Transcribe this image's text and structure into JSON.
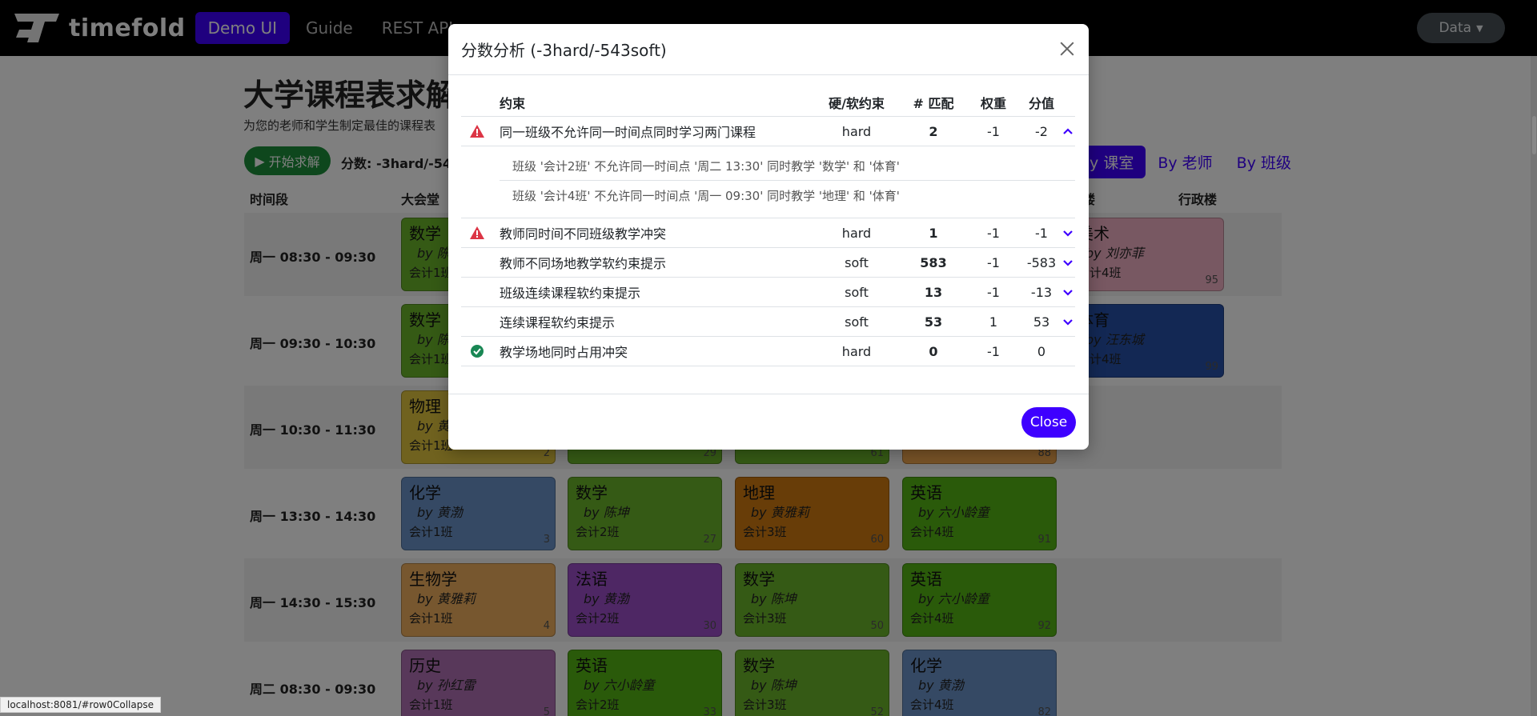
{
  "navbar": {
    "brand": "timefold",
    "links": [
      "Demo UI",
      "Guide",
      "REST API"
    ],
    "data_button": "Data"
  },
  "page": {
    "title": "大学课程表求解",
    "subtitle": "为您的老师和学生制定最佳的课程表",
    "solve_button": "开始求解",
    "score_label": "分数: -3hard/-543soft",
    "view_tabs": [
      "By 课室",
      "By 老师",
      "By 班级"
    ],
    "columns": [
      "时间段",
      "大会堂",
      "东楼",
      "行政楼"
    ],
    "rows": [
      {
        "time": "周一 08:30 - 09:30",
        "lessons": [
          {
            "subject": "数学",
            "teacher": "by 陈坤",
            "group": "会计1班",
            "id": "1",
            "color": "#6bb42b"
          },
          {
            "subject": "美术",
            "teacher": "by 刘亦菲",
            "group": "会计4班",
            "id": "95",
            "color": "#f0b0c4"
          }
        ]
      },
      {
        "time": "周一 09:30 - 10:30",
        "lessons": [
          {
            "subject": "数学",
            "teacher": "by 陈坤",
            "group": "会计1班",
            "id": "1",
            "color": "#6bb42b"
          },
          {
            "subject": "体育",
            "teacher": "by 汪东城",
            "group": "会计4班",
            "id": "99",
            "color": "#2650a8"
          }
        ]
      },
      {
        "time": "周一 10:30 - 11:30",
        "lessons": [
          {
            "subject": "物理",
            "teacher": "by 黄渤",
            "group": "会计1班",
            "id": "2",
            "color": "#e0c43e"
          },
          {
            "subject": "",
            "teacher": "",
            "group": "会计2班",
            "id": "29",
            "color": "#6bb42b"
          },
          {
            "subject": "",
            "teacher": "",
            "group": "会计3班",
            "id": "61",
            "color": "#6bb42b"
          },
          {
            "subject": "",
            "teacher": "",
            "group": "会计4班",
            "id": "88",
            "color": "#f0a64e"
          }
        ]
      },
      {
        "time": "周一 13:30 - 14:30",
        "lessons": [
          {
            "subject": "化学",
            "teacher": "by 黄渤",
            "group": "会计1班",
            "id": "3",
            "color": "#6a93c8"
          },
          {
            "subject": "数学",
            "teacher": "by 陈坤",
            "group": "会计2班",
            "id": "27",
            "color": "#6bb42b"
          },
          {
            "subject": "地理",
            "teacher": "by 黄雅莉",
            "group": "会计3班",
            "id": "60",
            "color": "#d07a10"
          },
          {
            "subject": "英语",
            "teacher": "by 六小龄童",
            "group": "会计4班",
            "id": "91",
            "color": "#55b414"
          }
        ]
      },
      {
        "time": "周一 14:30 - 15:30",
        "lessons": [
          {
            "subject": "生物学",
            "teacher": "by 黄雅莉",
            "group": "会计1班",
            "id": "4",
            "color": "#eeae5e"
          },
          {
            "subject": "法语",
            "teacher": "by 黄渤",
            "group": "会计2班",
            "id": "30",
            "color": "#9c4ec8"
          },
          {
            "subject": "数学",
            "teacher": "by 陈坤",
            "group": "会计3班",
            "id": "50",
            "color": "#6bb42b"
          },
          {
            "subject": "英语",
            "teacher": "by 六小龄童",
            "group": "会计4班",
            "id": "92",
            "color": "#55b414"
          }
        ]
      },
      {
        "time": "周二 08:30 - 09:30",
        "lessons": [
          {
            "subject": "历史",
            "teacher": "by 孙红雷",
            "group": "会计1班",
            "id": "5",
            "color": "#b070b4"
          },
          {
            "subject": "英语",
            "teacher": "by 六小龄童",
            "group": "会计2班",
            "id": "33",
            "color": "#55b414"
          },
          {
            "subject": "数学",
            "teacher": "by 陈坤",
            "group": "会计3班",
            "id": "52",
            "color": "#6bb42b"
          },
          {
            "subject": "化学",
            "teacher": "by 黄渤",
            "group": "会计4班",
            "id": "82",
            "color": "#6a93c8"
          }
        ]
      }
    ]
  },
  "modal": {
    "title": "分数分析 (-3hard/-543soft)",
    "headers": {
      "constraint": "约束",
      "type": "硬/软约束",
      "matches": "# 匹配",
      "weight": "权重",
      "score": "分值"
    },
    "constraints": [
      {
        "icon": "warning",
        "name": "同一班级不允许同一时间点同时学习两门课程",
        "type": "hard",
        "matches": "2",
        "weight": "-1",
        "score": "-2",
        "expand": "up"
      },
      {
        "icon": "warning",
        "name": "教师同时间不同班级教学冲突",
        "type": "hard",
        "matches": "1",
        "weight": "-1",
        "score": "-1",
        "expand": "down"
      },
      {
        "icon": "",
        "name": "教师不同场地教学软约束提示",
        "type": "soft",
        "matches": "583",
        "weight": "-1",
        "score": "-583",
        "expand": "down"
      },
      {
        "icon": "",
        "name": "班级连续课程软约束提示",
        "type": "soft",
        "matches": "13",
        "weight": "-1",
        "score": "-13",
        "expand": "down"
      },
      {
        "icon": "",
        "name": "连续课程软约束提示",
        "type": "soft",
        "matches": "53",
        "weight": "1",
        "score": "53",
        "expand": "down"
      },
      {
        "icon": "check",
        "name": "教学场地同时占用冲突",
        "type": "hard",
        "matches": "0",
        "weight": "-1",
        "score": "0",
        "expand": ""
      }
    ],
    "details": [
      "班级 '会计2班' 不允许同一时间点 '周二 13:30' 同时教学 '数学' 和 '体育'",
      "班级 '会计4班' 不允许同一时间点 '周一 09:30' 同时教学 '地理' 和 '体育'"
    ],
    "close_button": "Close"
  },
  "status_url": "localhost:8081/#row0Collapse",
  "colors": {
    "accent": "#3E00FF",
    "danger": "#dc3545",
    "success": "#198754"
  }
}
